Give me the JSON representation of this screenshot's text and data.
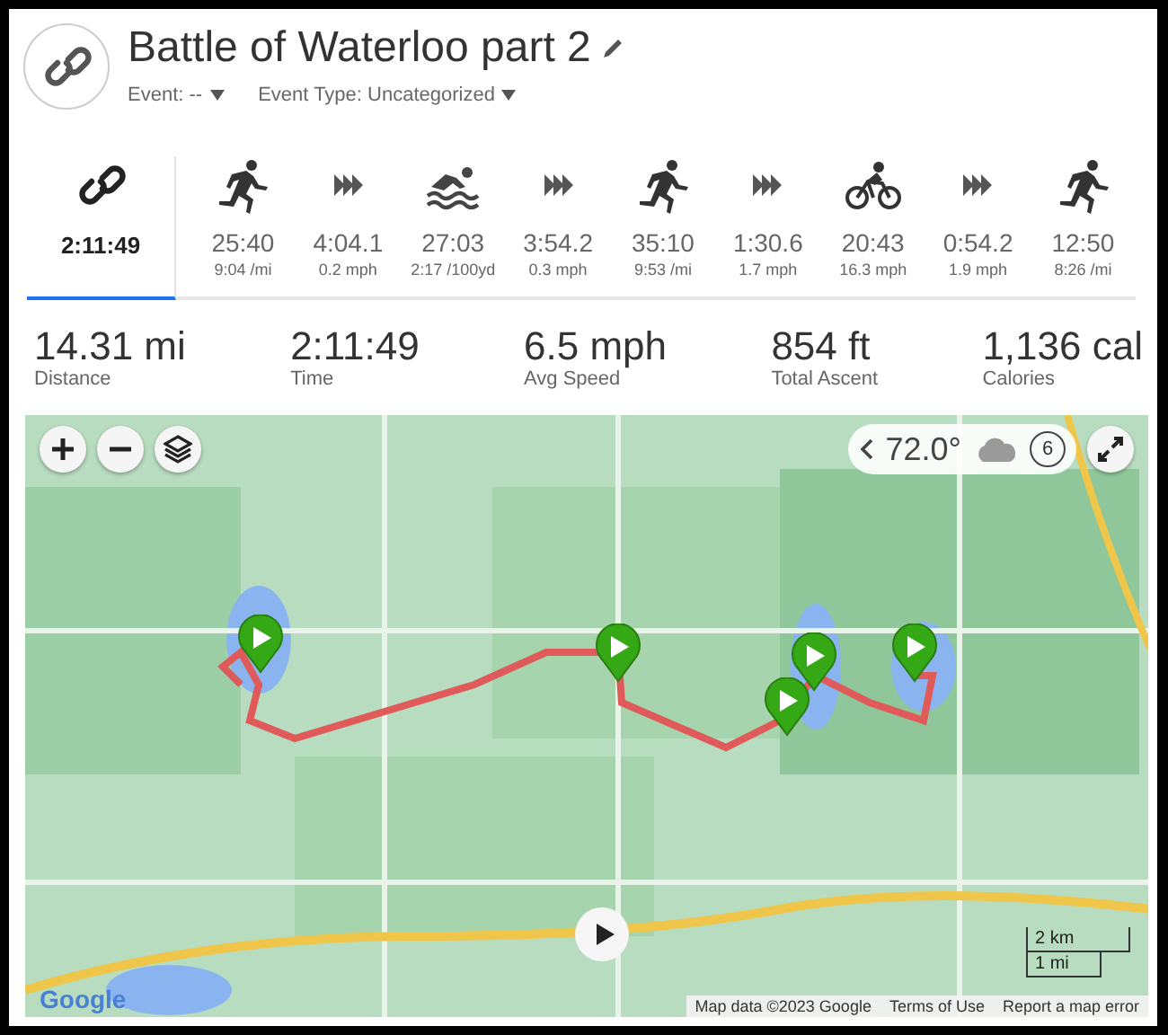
{
  "header": {
    "title": "Battle of Waterloo part 2",
    "event": "Event: --",
    "event_type": "Event Type: Uncategorized"
  },
  "segments": [
    {
      "kind": "multisport",
      "value": "2:11:49",
      "selected": true
    },
    {
      "kind": "run",
      "value": "25:40",
      "sub": "9:04 /mi",
      "selected": false
    },
    {
      "kind": "transition",
      "value": "4:04.1",
      "sub": "0.2 mph",
      "selected": false
    },
    {
      "kind": "swim",
      "value": "27:03",
      "sub": "2:17 /100yd",
      "selected": false
    },
    {
      "kind": "transition",
      "value": "3:54.2",
      "sub": "0.3 mph",
      "selected": false
    },
    {
      "kind": "run",
      "value": "35:10",
      "sub": "9:53 /mi",
      "selected": false
    },
    {
      "kind": "transition",
      "value": "1:30.6",
      "sub": "1.7 mph",
      "selected": false
    },
    {
      "kind": "bike",
      "value": "20:43",
      "sub": "16.3 mph",
      "selected": false
    },
    {
      "kind": "transition",
      "value": "0:54.2",
      "sub": "1.9 mph",
      "selected": false
    },
    {
      "kind": "run",
      "value": "12:50",
      "sub": "8:26 /mi",
      "selected": false
    }
  ],
  "stats": [
    {
      "value": "14.31 mi",
      "label": "Distance"
    },
    {
      "value": "2:11:49",
      "label": "Time"
    },
    {
      "value": "6.5 mph",
      "label": "Avg Speed"
    },
    {
      "value": "854 ft",
      "label": "Total Ascent"
    },
    {
      "value": "1,136 cal",
      "label": "Calories"
    }
  ],
  "map": {
    "kind": "picture",
    "weather": {
      "temperature": "72.0°",
      "index": "6"
    },
    "scale": [
      "2 km",
      "1 mi"
    ],
    "logo": "Google",
    "attribution": [
      "Map data ©2023 Google",
      "Terms of Use",
      "Report a map error"
    ]
  }
}
